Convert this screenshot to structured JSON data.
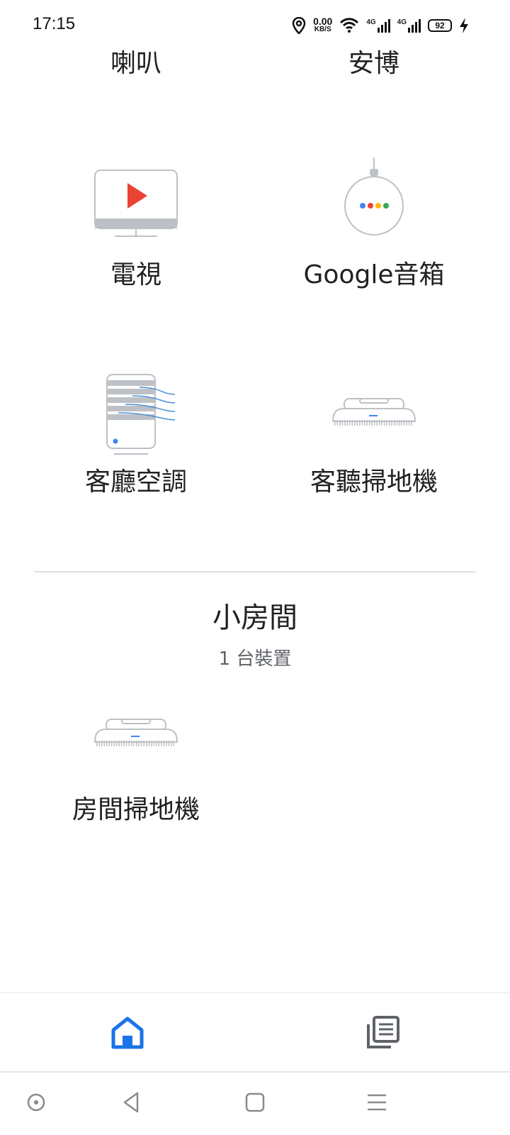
{
  "status_bar": {
    "time": "17:15",
    "net_speed_value": "0.00",
    "net_speed_unit": "KB/S",
    "network_1": "4G",
    "network_2": "4G",
    "battery": "92",
    "icons": [
      "location-icon",
      "wifi-icon",
      "signal-icon",
      "signal-icon",
      "battery-icon",
      "charging-icon"
    ]
  },
  "room_a": {
    "devices": [
      {
        "label": "喇叭",
        "icon": "speaker-icon"
      },
      {
        "label": "安博",
        "icon": "device-icon"
      },
      {
        "label": "電視",
        "icon": "tv-icon"
      },
      {
        "label": "Google音箱",
        "icon": "google-speaker-icon"
      },
      {
        "label": "客廳空調",
        "icon": "air-conditioner-icon"
      },
      {
        "label": "客聽掃地機",
        "icon": "robot-vacuum-icon"
      }
    ]
  },
  "room_b": {
    "title": "小房間",
    "subtitle": "1 台裝置",
    "devices": [
      {
        "label": "房間掃地機",
        "icon": "robot-vacuum-icon"
      }
    ]
  },
  "bottom_nav": {
    "items": [
      {
        "name": "home",
        "icon": "home-icon",
        "active": true
      },
      {
        "name": "feed",
        "icon": "feed-icon",
        "active": false
      }
    ],
    "active_color": "#1a73e8",
    "inactive_color": "#5f6368"
  },
  "system_nav": {
    "icons": [
      "assistant-icon",
      "back-icon",
      "home-square-icon",
      "menu-icon"
    ]
  }
}
